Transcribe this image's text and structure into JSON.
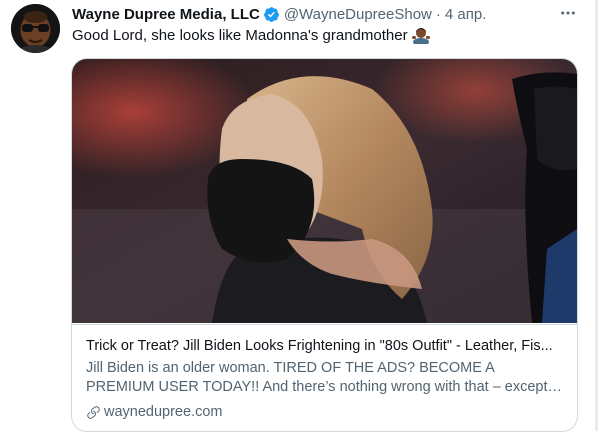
{
  "tweet": {
    "author_name": "Wayne Dupree Media, LLC",
    "handle": "@WayneDupreeShow",
    "separator": "·",
    "time": "4 апр.",
    "text": "Good Lord, she looks like Madonna's grandmother",
    "icons": {
      "verified": "verified-badge-icon",
      "more": "more-options-icon",
      "emoji": "man-shrugging-emoji",
      "link": "link-icon"
    }
  },
  "card": {
    "title": "Trick or Treat? Jill Biden Looks Frightening in \"80s Outfit\" - Leather, Fis...",
    "description": "Jill Biden is an older woman. TIRED OF THE ADS? BECOME A PREMIUM USER TODAY!! And there’s nothing wrong with that – except when old...",
    "domain": "waynedupree.com"
  },
  "colors": {
    "accent": "#1d9bf0",
    "secondary_text": "#536471",
    "border": "#cfd9de"
  }
}
